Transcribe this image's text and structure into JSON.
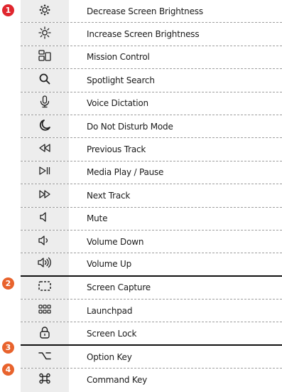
{
  "markers": [
    {
      "label": "1",
      "color": "#e0262e"
    },
    {
      "label": "2",
      "color": "#e8632d"
    },
    {
      "label": "3",
      "color": "#e8632d"
    },
    {
      "label": "4",
      "color": "#e8632d"
    }
  ],
  "shortcuts": [
    {
      "icon": "brightness-low-icon",
      "label": "Decrease Screen Brightness"
    },
    {
      "icon": "brightness-high-icon",
      "label": "Increase Screen Brightness"
    },
    {
      "icon": "mission-control-icon",
      "label": "Mission Control"
    },
    {
      "icon": "search-icon",
      "label": "Spotlight Search"
    },
    {
      "icon": "microphone-icon",
      "label": "Voice Dictation"
    },
    {
      "icon": "moon-icon",
      "label": "Do Not Disturb Mode"
    },
    {
      "icon": "rewind-icon",
      "label": "Previous Track"
    },
    {
      "icon": "play-pause-icon",
      "label": "Media Play / Pause"
    },
    {
      "icon": "fast-forward-icon",
      "label": "Next Track"
    },
    {
      "icon": "speaker-mute-icon",
      "label": "Mute"
    },
    {
      "icon": "speaker-low-icon",
      "label": "Volume Down"
    },
    {
      "icon": "speaker-high-icon",
      "label": "Volume Up"
    },
    {
      "icon": "screen-capture-icon",
      "label": "Screen Capture"
    },
    {
      "icon": "launchpad-icon",
      "label": "Launchpad"
    },
    {
      "icon": "lock-icon",
      "label": "Screen Lock"
    },
    {
      "icon": "option-key-icon",
      "label": "Option Key"
    },
    {
      "icon": "command-key-icon",
      "label": "Command Key"
    }
  ]
}
